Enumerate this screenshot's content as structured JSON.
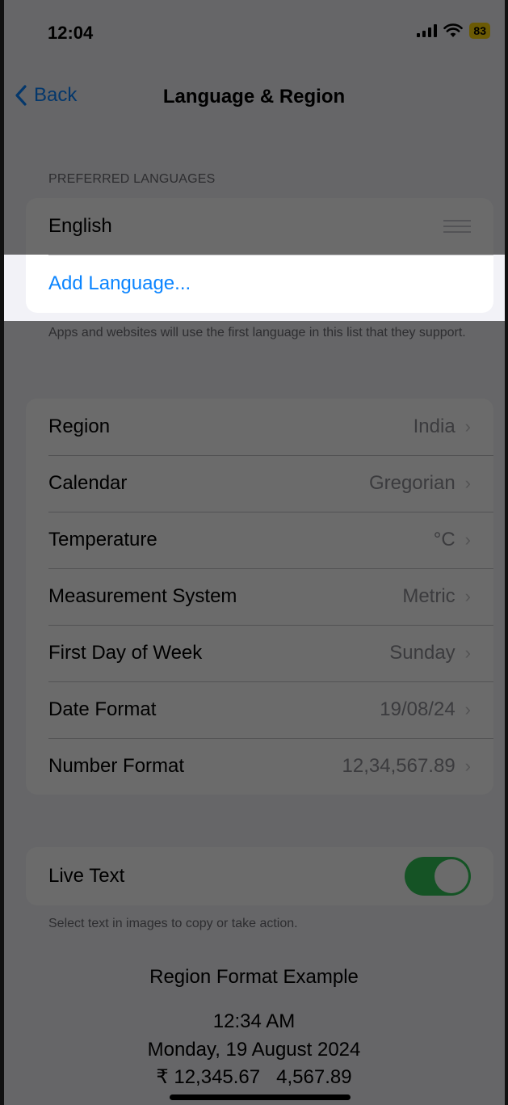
{
  "status_bar": {
    "time": "12:04",
    "battery": "83"
  },
  "nav": {
    "back_label": "Back",
    "title": "Language & Region"
  },
  "preferred_languages": {
    "header": "PREFERRED LANGUAGES",
    "items": [
      {
        "label": "English"
      }
    ],
    "add_label": "Add Language...",
    "footer": "Apps and websites will use the first language in this list that they support."
  },
  "settings": [
    {
      "label": "Region",
      "value": "India"
    },
    {
      "label": "Calendar",
      "value": "Gregorian"
    },
    {
      "label": "Temperature",
      "value": "°C"
    },
    {
      "label": "Measurement System",
      "value": "Metric"
    },
    {
      "label": "First Day of Week",
      "value": "Sunday"
    },
    {
      "label": "Date Format",
      "value": "19/08/24"
    },
    {
      "label": "Number Format",
      "value": "12,34,567.89"
    }
  ],
  "live_text": {
    "label": "Live Text",
    "enabled": true,
    "footer": "Select text in images to copy or take action."
  },
  "region_example": {
    "title": "Region Format Example",
    "time": "12:34 AM",
    "date": "Monday, 19 August 2024",
    "numbers": "₹ 12,345.67   4,567.89"
  },
  "colors": {
    "accent": "#0a84ff",
    "toggle_on": "#34c759",
    "battery": "#ffd60a"
  },
  "icons": {
    "back": "chevron-left-icon",
    "disclosure": "chevron-right-icon",
    "reorder": "reorder-handle-icon"
  }
}
